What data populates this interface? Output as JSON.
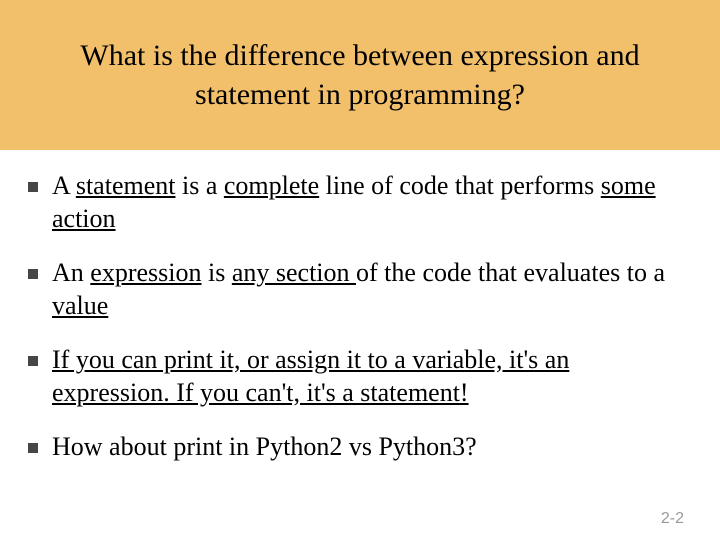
{
  "header": {
    "title": "What is the difference between expression and statement in programming?"
  },
  "bullets": {
    "b1": {
      "pre": "A ",
      "u1": "statement",
      "mid1": " is a ",
      "u2": "complete",
      "mid2": " line of code that performs ",
      "u3": "some action"
    },
    "b2": {
      "pre": " An ",
      "u1": "expression",
      "mid1": " is ",
      "u2": "any section ",
      "mid2": "of the code that evaluates to a ",
      "u3": "value"
    },
    "b3": {
      "u1": "If you can print it, or assign it to a variable, it's an expression. If you can't, it's a statement!"
    },
    "b4": {
      "text": "How about print in Python2  vs Python3?"
    }
  },
  "footer": {
    "page": "2-2"
  }
}
